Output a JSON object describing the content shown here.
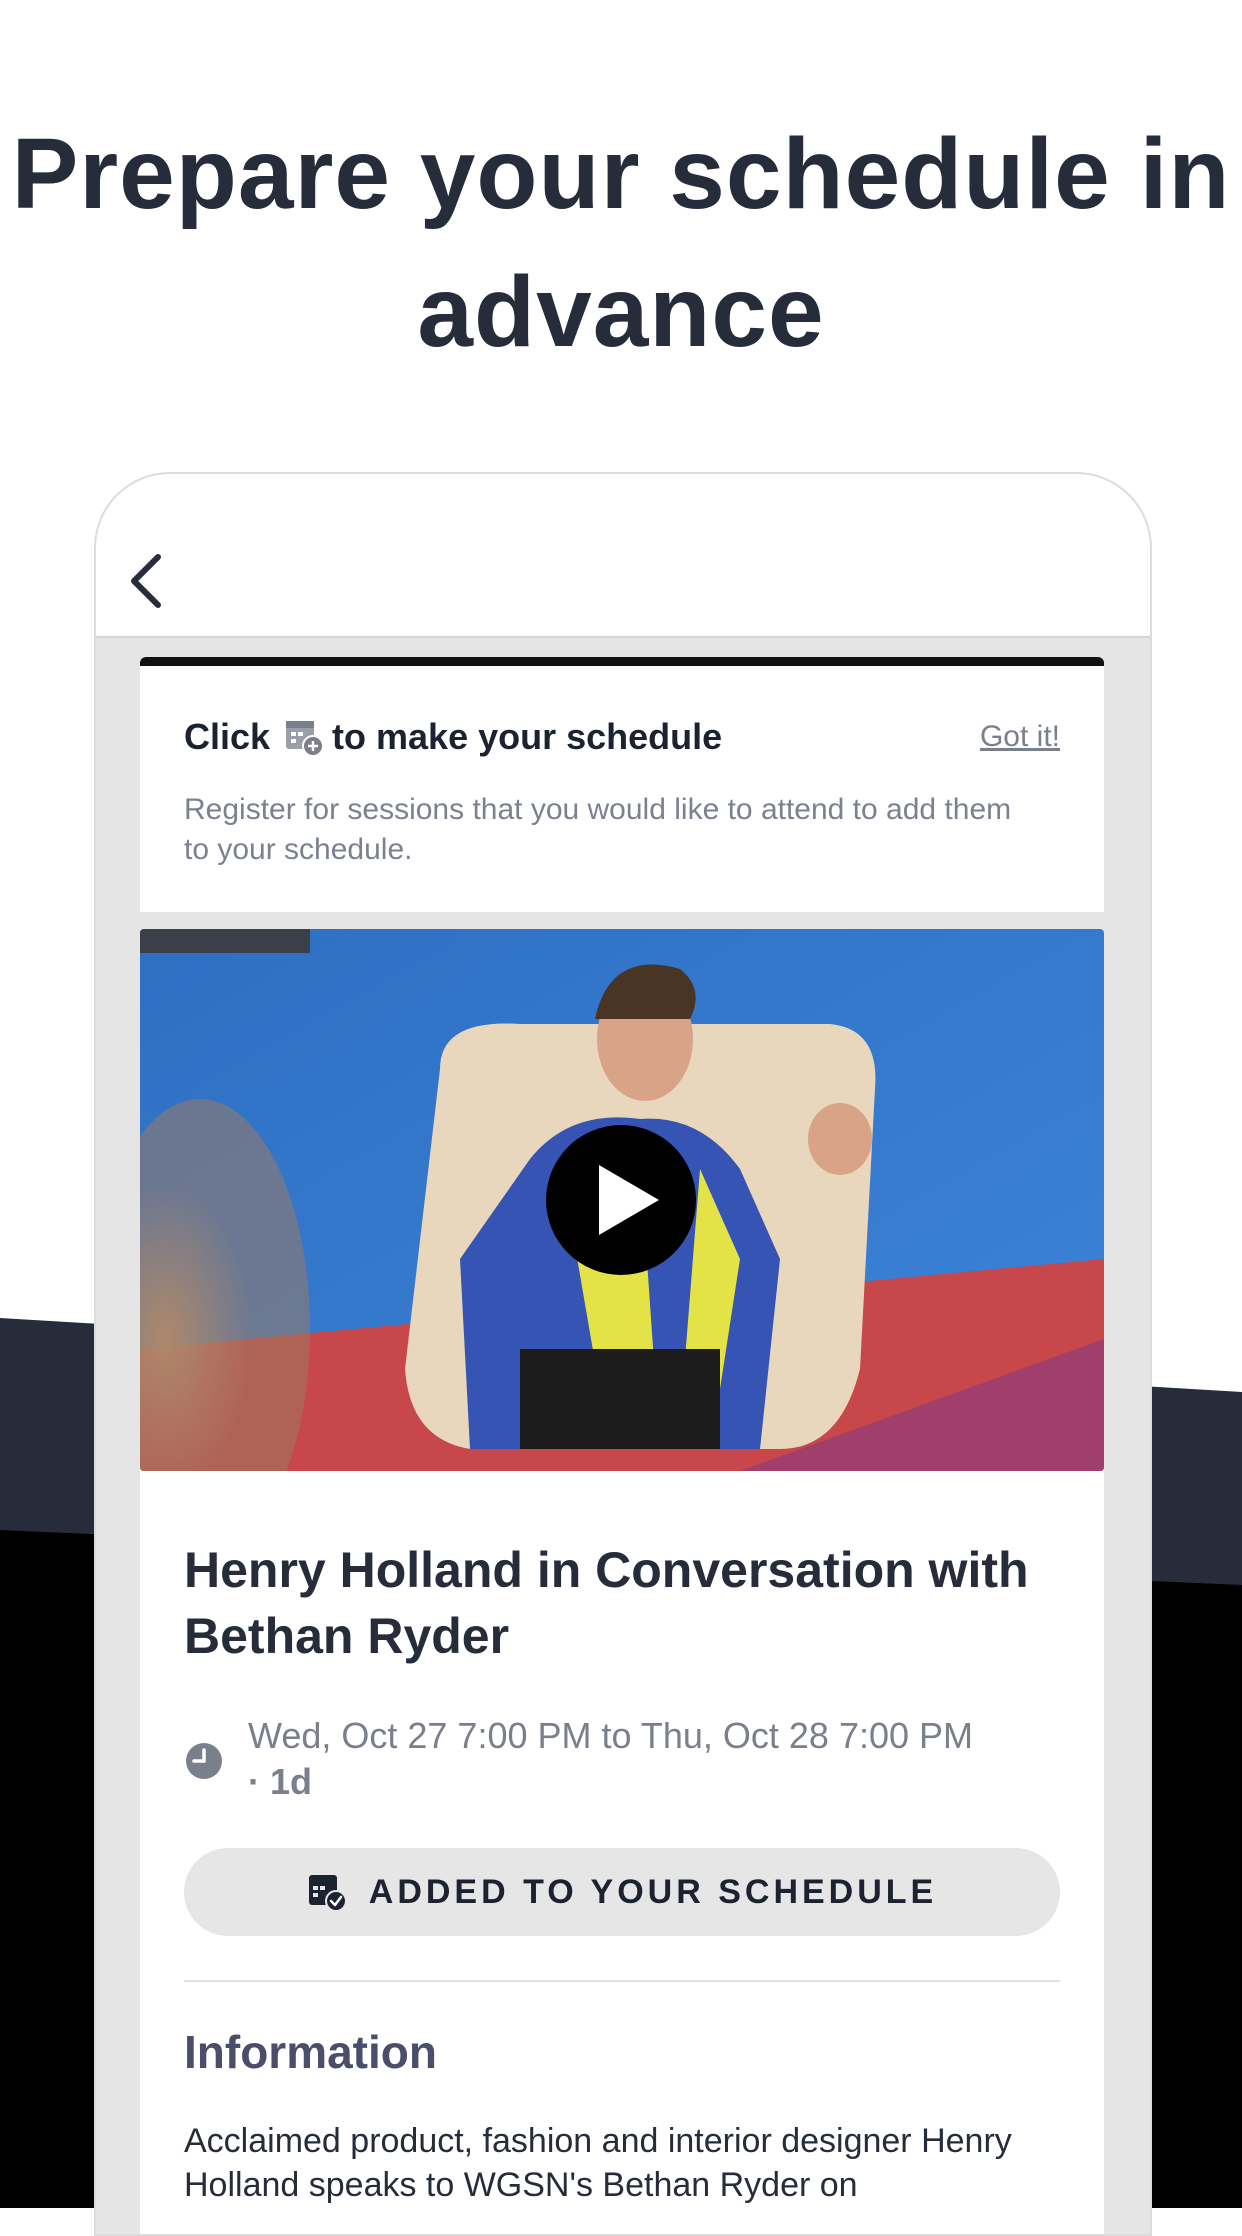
{
  "headline": "Prepare your schedule in advance",
  "tip": {
    "title_before": "Click",
    "title_after": "to make your schedule",
    "dismiss": "Got it!",
    "body": "Register for sessions that you would like to attend to add them to your schedule."
  },
  "session": {
    "title": "Henry Holland in Conversation with Bethan Ryder",
    "datetime": "Wed, Oct 27 7:00 PM to Thu, Oct 28 7:00 PM",
    "duration": "1d",
    "schedule_button": "ADDED TO YOUR SCHEDULE"
  },
  "information": {
    "heading": "Information",
    "body": "Acclaimed product, fashion and interior designer Henry Holland speaks to WGSN's Bethan Ryder on"
  },
  "icons": {
    "back": "chevron-left-icon",
    "add_to_schedule": "calendar-add-icon",
    "added": "calendar-check-icon",
    "clock": "clock-icon",
    "play": "play-icon"
  },
  "colors": {
    "navy": "#262c3a",
    "muted_text": "#7a7f8c",
    "card_bg": "#e5e5e5",
    "button_bg": "#e6e6e6",
    "info_heading": "#4a4e68"
  }
}
